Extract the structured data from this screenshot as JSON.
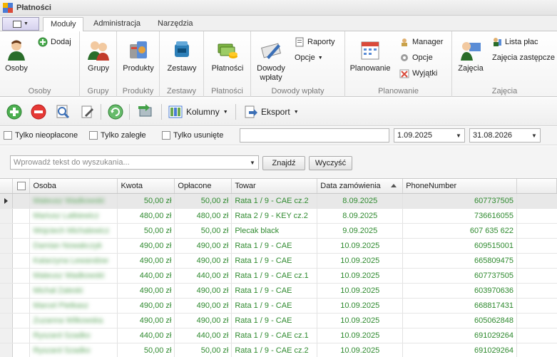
{
  "window": {
    "title": "Płatności"
  },
  "tabs": [
    {
      "label": "Moduły",
      "active": true
    },
    {
      "label": "Administracja",
      "active": false
    },
    {
      "label": "Narzędzia",
      "active": false
    }
  ],
  "ribbon": {
    "osoby": {
      "big": "Osoby",
      "small": "Dodaj",
      "caption": "Osoby"
    },
    "grupy": {
      "big": "Grupy",
      "caption": "Grupy"
    },
    "produkty": {
      "big": "Produkty",
      "caption": "Produkty"
    },
    "zestawy": {
      "big": "Zestawy",
      "caption": "Zestawy"
    },
    "platnosci": {
      "big": "Płatności",
      "caption": "Płatności"
    },
    "dowody": {
      "big1": "Dowody",
      "big2": "wpłaty",
      "raporty": "Raporty",
      "opcje": "Opcje",
      "caption": "Dowody wpłaty"
    },
    "planowanie": {
      "big": "Planowanie",
      "manager": "Manager",
      "opcje": "Opcje",
      "wyjatki": "Wyjątki",
      "caption": "Planowanie"
    },
    "zajecia": {
      "big": "Zajęcia",
      "lista": "Lista płac",
      "zastepcze": "Zajęcia zastępcze",
      "caption": "Zajęcia"
    }
  },
  "toolbar": {
    "kolumny": "Kolumny",
    "eksport": "Eksport"
  },
  "filters": {
    "unpaid": "Tylko nieopłacone",
    "overdue": "Tylko zaległe",
    "deleted": "Tylko usunięte",
    "date_from": "1.09.2025",
    "date_to": "31.08.2026"
  },
  "search": {
    "placeholder": "Wprowadź tekst do wyszukania...",
    "find": "Znajdź",
    "clear": "Wyczyść"
  },
  "grid": {
    "columns": [
      "Osoba",
      "Kwota",
      "Opłacone",
      "Towar",
      "Data zamówienia",
      "PhoneNumber"
    ],
    "rows": [
      [
        "Mateusz Wadkowski",
        "50,00 zł",
        "50,00 zł",
        "Rata 1 / 9 - CAE cz.2",
        "8.09.2025",
        "607737505"
      ],
      [
        "Mariusz Latkiewicz",
        "480,00 zł",
        "480,00 zł",
        "Rata 2 / 9 - KEY cz.2",
        "8.09.2025",
        "736616055"
      ],
      [
        "Wojciech Michalewicz",
        "50,00 zł",
        "50,00 zł",
        "Plecak black",
        "9.09.2025",
        "607 635 622"
      ],
      [
        "Damian Nowakczyk",
        "490,00 zł",
        "490,00 zł",
        "Rata 1 / 9 - CAE",
        "10.09.2025",
        "609515001"
      ],
      [
        "Katarzyna Lewandow",
        "490,00 zł",
        "490,00 zł",
        "Rata 1 / 9 - CAE",
        "10.09.2025",
        "665809475"
      ],
      [
        "Mateusz Wadkowski",
        "440,00 zł",
        "440,00 zł",
        "Rata 1 / 9 - CAE cz.1",
        "10.09.2025",
        "607737505"
      ],
      [
        "Michał Zaleski",
        "490,00 zł",
        "490,00 zł",
        "Rata 1 / 9 - CAE",
        "10.09.2025",
        "603970636"
      ],
      [
        "Marcel Pietkasz",
        "490,00 zł",
        "490,00 zł",
        "Rata 1 / 9 - CAE",
        "10.09.2025",
        "668817431"
      ],
      [
        "Zuzanna Wilkowska",
        "490,00 zł",
        "490,00 zł",
        "Rata 1 / 9 - CAE",
        "10.09.2025",
        "605062848"
      ],
      [
        "Ryszard Szadko",
        "440,00 zł",
        "440,00 zł",
        "Rata 1 / 9 - CAE cz.1",
        "10.09.2025",
        "691029264"
      ],
      [
        "Ryszard Szadko",
        "50,00 zł",
        "50,00 zł",
        "Rata 1 / 9 - CAE cz.2",
        "10.09.2025",
        "691029264"
      ]
    ]
  },
  "colors": {
    "accent_green": "#2f8a2f",
    "selected_row": "#e8e8e8"
  }
}
